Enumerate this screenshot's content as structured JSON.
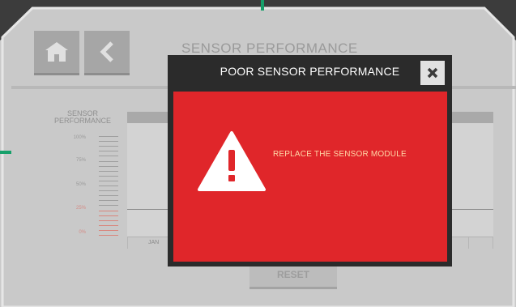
{
  "page": {
    "title": "SENSOR PERFORMANCE",
    "nav": {
      "home_icon": "home-icon",
      "back_icon": "chevron-left-icon"
    }
  },
  "performance_scale": {
    "label_line1": "SENSOR",
    "label_line2": "PERFORMANCE",
    "ticks": [
      "100%",
      "75%",
      "50%",
      "25%",
      "0%"
    ]
  },
  "chart": {
    "months": [
      "JAN"
    ]
  },
  "reset_label": "RESET",
  "modal": {
    "title": "POOR SENSOR PERFORMANCE",
    "close_icon": "close-icon",
    "warning_icon": "warning-triangle-icon",
    "message": "REPLACE THE SENSOR MODULE",
    "body_color": "#e0262a"
  }
}
